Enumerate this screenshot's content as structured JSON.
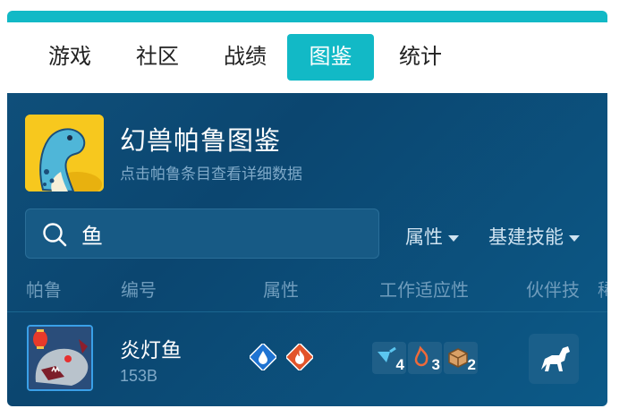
{
  "tabs": [
    {
      "label": "游戏"
    },
    {
      "label": "社区"
    },
    {
      "label": "战绩"
    },
    {
      "label": "图鉴"
    },
    {
      "label": "统计"
    }
  ],
  "active_tab": "图鉴",
  "header": {
    "title": "幻兽帕鲁图鉴",
    "subtitle": "点击帕鲁条目查看详细数据"
  },
  "search": {
    "value": "鱼"
  },
  "filters": {
    "attribute": "属性",
    "base_skill": "基建技能"
  },
  "columns": [
    "帕鲁",
    "编号",
    "属性",
    "工作适应性",
    "伙伴技",
    "稀"
  ],
  "rows": [
    {
      "name": "炎灯鱼",
      "number": "153B",
      "elements": [
        "water-icon",
        "fire-icon"
      ],
      "work": [
        {
          "icon": "watering-icon",
          "level": "4"
        },
        {
          "icon": "kindling-icon",
          "level": "3"
        },
        {
          "icon": "transporting-icon",
          "level": "2"
        }
      ],
      "partner_skill_icon": "horse-icon"
    }
  ],
  "colors": {
    "accent": "#12b9c6",
    "panel_bg": "#0b4670",
    "water": "#1e73d2",
    "fire": "#e2542a"
  }
}
